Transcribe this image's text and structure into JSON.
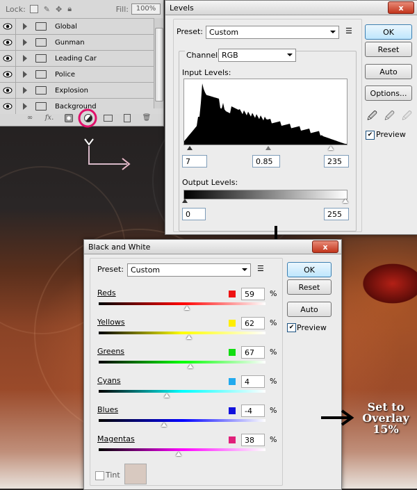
{
  "layers_panel": {
    "lock_label": "Lock:",
    "fill_label": "Fill:",
    "fill_value": "100%",
    "layers": [
      "Global",
      "Gunman",
      "Leading Car",
      "Police",
      "Explosion",
      "Background"
    ],
    "footer_icons": [
      "link-icon",
      "fx-icon",
      "mask-icon",
      "adjustment-layer-icon",
      "group-folder-icon",
      "new-layer-icon",
      "trash-icon"
    ],
    "fx_label": "fx."
  },
  "levels": {
    "title": "Levels",
    "close_glyph": "x",
    "preset_label": "Preset:",
    "preset_value": "Custom",
    "channel_label": "Channel:",
    "channel_value": "RGB",
    "input_levels_label": "Input Levels:",
    "input_black": "7",
    "input_gamma": "0.85",
    "input_white": "235",
    "output_levels_label": "Output Levels:",
    "output_black": "0",
    "output_white": "255",
    "buttons": {
      "ok": "OK",
      "reset": "Reset",
      "auto": "Auto",
      "options": "Options..."
    },
    "preview_label": "Preview",
    "preview_checked": true
  },
  "bw": {
    "title": "Black and White",
    "close_glyph": "x",
    "preset_label": "Preset:",
    "preset_value": "Custom",
    "buttons": {
      "ok": "OK",
      "reset": "Reset",
      "auto": "Auto"
    },
    "preview_label": "Preview",
    "preview_checked": true,
    "percent_symbol": "%",
    "channels": [
      {
        "label": "Reds",
        "value": "59",
        "color": "#ee1111",
        "slider_pos": 0.53,
        "grad": "linear-gradient(90deg,#000,#ff0000,#fff)"
      },
      {
        "label": "Yellows",
        "value": "62",
        "color": "#ffee00",
        "slider_pos": 0.54,
        "grad": "linear-gradient(90deg,#000,#ffff00,#fff)"
      },
      {
        "label": "Greens",
        "value": "67",
        "color": "#11dd11",
        "slider_pos": 0.55,
        "grad": "linear-gradient(90deg,#000,#00ff00,#fff)"
      },
      {
        "label": "Cyans",
        "value": "4",
        "color": "#22aaee",
        "slider_pos": 0.41,
        "grad": "linear-gradient(90deg,#000,#00ffff,#fff)"
      },
      {
        "label": "Blues",
        "value": "-4",
        "color": "#1111dd",
        "slider_pos": 0.39,
        "grad": "linear-gradient(90deg,#000,#0000ff,#fff)"
      },
      {
        "label": "Magentas",
        "value": "38",
        "color": "#e0207a",
        "slider_pos": 0.48,
        "grad": "linear-gradient(90deg,#000,#ff00ff,#fff)"
      }
    ],
    "tint_label": "Tint",
    "tint_checked": false
  },
  "annotation": {
    "note_line1": "Set to",
    "note_line2": "Overlay",
    "note_line3": "15%"
  },
  "colors": {
    "highlight_circle": "#e0106a",
    "ok_border": "#3c7fb1"
  }
}
